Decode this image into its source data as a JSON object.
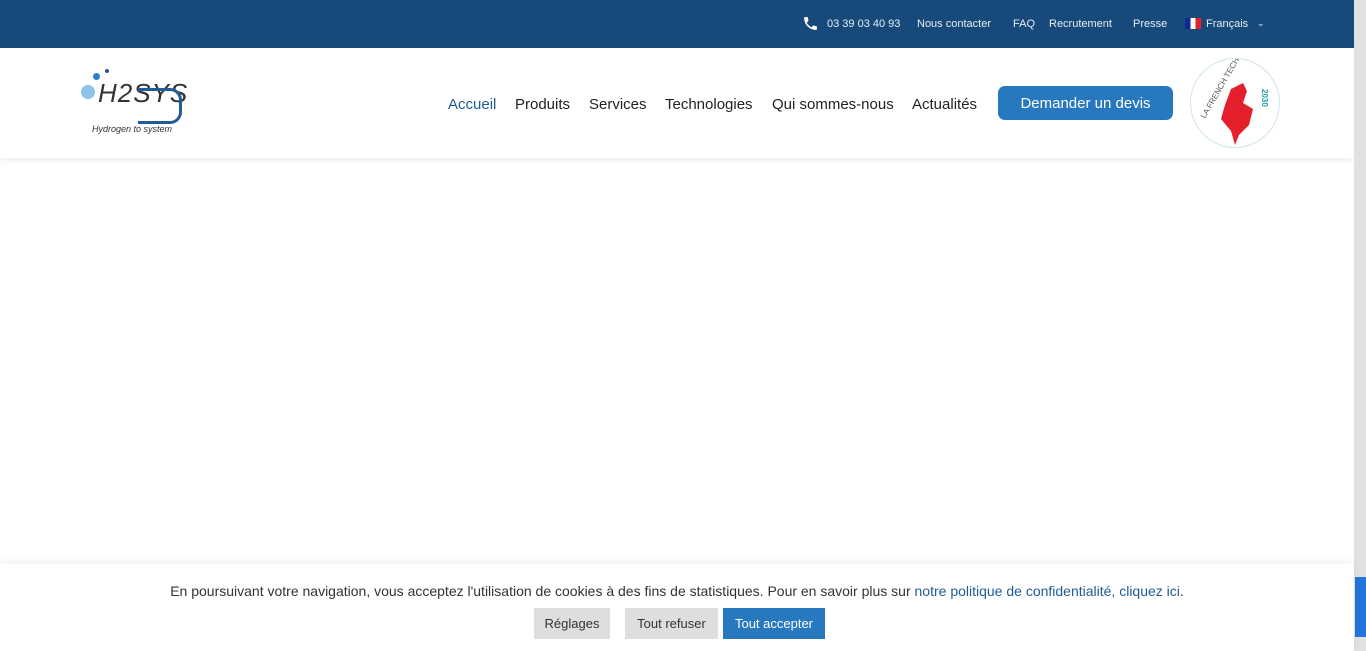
{
  "topbar": {
    "phone": "03 39 03 40 93",
    "contact": "Nous contacter",
    "faq": "FAQ",
    "jobs": "Recrutement",
    "press": "Presse",
    "language": "Français"
  },
  "logo": {
    "text": "H2SYS",
    "tagline": "Hydrogen to system"
  },
  "nav": {
    "items": [
      "Accueil",
      "Produits",
      "Services",
      "Technologies",
      "Qui sommes-nous",
      "Actualités"
    ],
    "active": "Accueil",
    "cta": "Demander un devis"
  },
  "badge": {
    "text": "LA FRENCH TECH",
    "year": "2030"
  },
  "cookie": {
    "message": "En poursuivant votre navigation, vous acceptez l'utilisation de cookies à des fins de statistiques. Pour en savoir plus sur ",
    "link": "notre politique de confidentialité, cliquez ici",
    "end": ".",
    "settings": "Réglages",
    "reject": "Tout refuser",
    "accept": "Tout accepter"
  },
  "colors": {
    "topbar": "#174a7a",
    "accent": "#2878c0"
  }
}
